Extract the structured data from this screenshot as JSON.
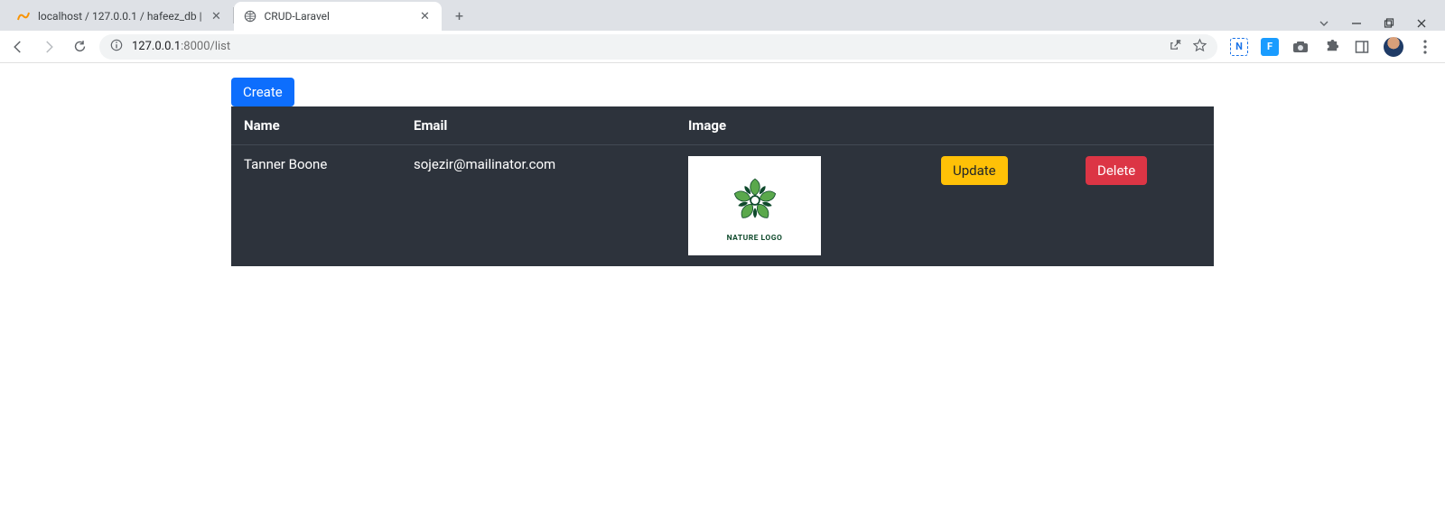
{
  "browser": {
    "tabs": [
      {
        "title": "localhost / 127.0.0.1 / hafeez_db |",
        "active": false
      },
      {
        "title": "CRUD-Laravel",
        "active": true
      }
    ],
    "url_host": "127.0.0.1",
    "url_port": ":8000",
    "url_path": "/list"
  },
  "page": {
    "create_label": "Create",
    "headers": {
      "name": "Name",
      "email": "Email",
      "image": "Image"
    },
    "rows": [
      {
        "name": "Tanner Boone",
        "email": "sojezir@mailinator.com",
        "image_caption": "NATURE LOGO",
        "update_label": "Update",
        "delete_label": "Delete"
      }
    ]
  }
}
